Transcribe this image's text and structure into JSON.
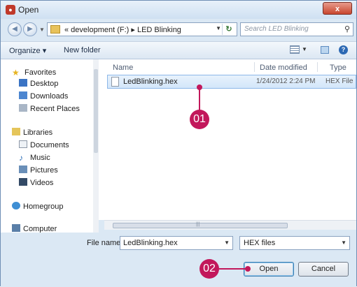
{
  "window": {
    "title": "Open",
    "close_label": "x"
  },
  "nav": {
    "address_path": "« development (F:) ▸ LED Blinking",
    "search_placeholder": "Search LED Blinking"
  },
  "toolbar": {
    "organize_label": "Organize ▾",
    "new_folder_label": "New folder"
  },
  "sidebar": {
    "favorites": "Favorites",
    "desktop": "Desktop",
    "downloads": "Downloads",
    "recent_places": "Recent Places",
    "libraries": "Libraries",
    "documents": "Documents",
    "music": "Music",
    "pictures": "Pictures",
    "videos": "Videos",
    "homegroup": "Homegroup",
    "computer": "Computer"
  },
  "columns": {
    "name": "Name",
    "date_modified": "Date modified",
    "type": "Type"
  },
  "files": [
    {
      "name": "LedBlinking.hex",
      "date": "1/24/2012 2:24 PM",
      "type": "HEX File"
    }
  ],
  "footer": {
    "file_name_label": "File name:",
    "file_name_value": "LedBlinking.hex",
    "filter_value": "HEX files",
    "open_label": "Open",
    "cancel_label": "Cancel"
  },
  "callouts": {
    "step1": "01",
    "step2": "02"
  },
  "colors": {
    "callout": "#c2185b",
    "selection": "#d3e6fa",
    "close": "#c8462e"
  }
}
